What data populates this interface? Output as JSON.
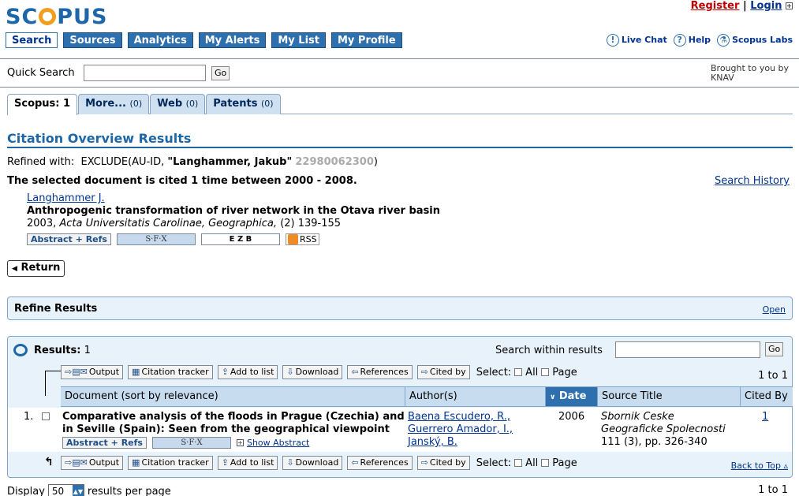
{
  "header": {
    "logo": "SCOPUS",
    "register": "Register",
    "login": "Login",
    "separator": "|",
    "nav": [
      "Search",
      "Sources",
      "Analytics",
      "My Alerts",
      "My List",
      "My Profile"
    ],
    "right_nav": [
      "Live Chat",
      "Help",
      "Scopus Labs"
    ]
  },
  "quick_search": {
    "label": "Quick Search",
    "value": "",
    "go": "Go",
    "brought_line1": "Brought to you by",
    "brought_line2": "KNAV"
  },
  "tabs": [
    {
      "label": "Scopus: 1",
      "count": ""
    },
    {
      "label": "More...",
      "count": "(0)"
    },
    {
      "label": "Web",
      "count": "(0)"
    },
    {
      "label": "Patents",
      "count": "(0)"
    }
  ],
  "page": {
    "title": "Citation Overview Results",
    "refined_prefix": "Refined with:",
    "refined_exclude": "EXCLUDE(AU-ID,",
    "refined_name": "\"Langhammer, Jakub\"",
    "refined_id": "22980062300",
    "refined_close": ")",
    "cited_sentence": "The selected document is cited 1 time between 2000 - 2008.",
    "search_history": "Search History"
  },
  "document": {
    "author": "Langhammer J.",
    "title": "Anthropogenic transformation of river network in the Otava river basin",
    "year": "2003,",
    "journal": "Acta Universitatis Carolinae, Geographica,",
    "issue": "(2) 139-155",
    "abstract_btn": "Abstract + Refs",
    "sfx": "S·F·X",
    "ezb": "E Z B",
    "rss": "RSS"
  },
  "return_btn": "Return",
  "refine": {
    "title": "Refine Results",
    "open": "Open"
  },
  "results": {
    "label": "Results:",
    "count": "1",
    "search_within": "Search within results",
    "search_value": "",
    "go": "Go",
    "toolbar": [
      "Output",
      "Citation tracker",
      "Add to list",
      "Download",
      "References",
      "Cited by"
    ],
    "select": "Select:",
    "all": "All",
    "page": "Page",
    "paging": "1 to 1",
    "columns": [
      "Document (sort by relevance)",
      "Author(s)",
      "Date",
      "Source Title",
      "Cited By"
    ],
    "rows": [
      {
        "num": "1.",
        "title": "Comparative analysis of the floods in Prague (Czechia) and in Seville (Spain): Seen from the geographical viewpoint",
        "authors": [
          "Baena Escudero, R.,",
          "Guerrero Amador, I.,",
          "Janský, B."
        ],
        "date": "2006",
        "source_line1": "Sbornik Ceske",
        "source_line2": "Geograficke Spolecnosti",
        "source_line3": "111 (3), pp. 326-340",
        "cited_by": "1",
        "abstract_btn": "Abstract + Refs",
        "sfx": "S·F·X",
        "show_abstract": "Show Abstract"
      }
    ],
    "back_to_top": "Back to Top",
    "display_label": "Display",
    "display_value": "50",
    "per_page": "results per page",
    "paging_bottom": "1 to 1"
  }
}
